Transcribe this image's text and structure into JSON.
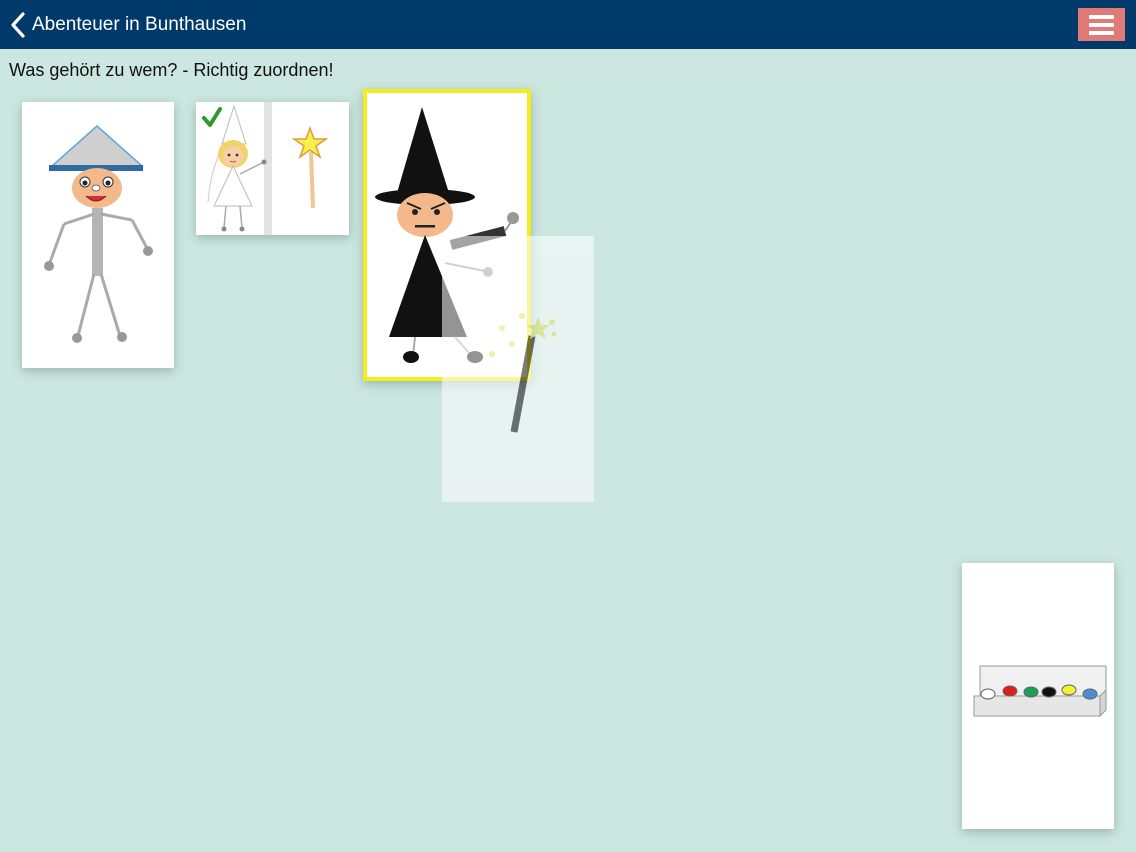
{
  "header": {
    "back_label": "Abenteuer in Bunthausen",
    "back_icon": "chevron-left-icon",
    "menu_icon": "hamburger-menu-icon",
    "background_color": "#003a6b",
    "menu_color": "#e07a76"
  },
  "instruction": "Was gehört zu wem? - Richtig zuordnen!",
  "cards": [
    {
      "name": "painter-card",
      "depicts": "boy with paper hat"
    },
    {
      "name": "fairy-wand-pair-card",
      "depicts": "fairy and magic wand",
      "matched": true
    },
    {
      "name": "witch-card",
      "depicts": "witch",
      "selected": true
    },
    {
      "name": "wand-card-dragging",
      "depicts": "magic wand",
      "dragging": true
    },
    {
      "name": "paint-box-card",
      "depicts": "paint box"
    }
  ],
  "colors": {
    "background": "#cce6e0",
    "selection_border": "#f2ee1e",
    "check": "#2e9a2e"
  }
}
